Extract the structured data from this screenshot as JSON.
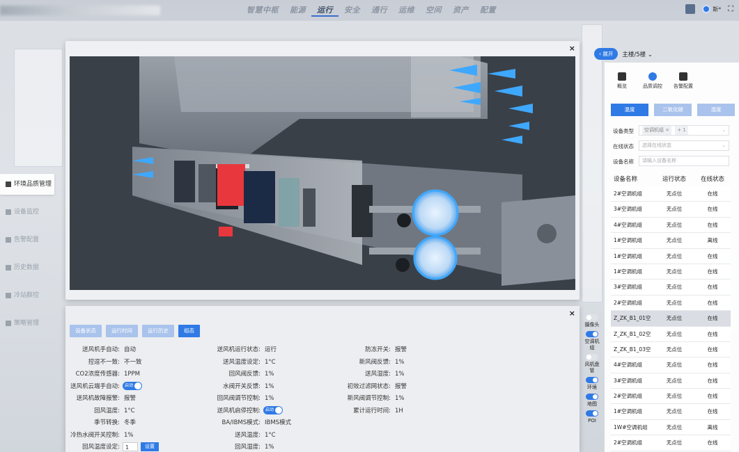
{
  "nav": {
    "items": [
      "智慧中枢",
      "能源",
      "运行",
      "安全",
      "通行",
      "运维",
      "空间",
      "资产",
      "配置"
    ],
    "active_index": 2
  },
  "top_right": {
    "user_name": "斯*"
  },
  "left_menu": {
    "items": [
      "环境品质管理",
      "设备监控",
      "告警配置",
      "历史数据",
      "冷站群控",
      "策略管理"
    ],
    "active_index": 0
  },
  "props": {
    "tabs": [
      "设备状态",
      "运行时间",
      "运行历史",
      "组态"
    ],
    "active_tab_index": 3,
    "col1": [
      {
        "label": "送风机手自动:",
        "value": "自动"
      },
      {
        "label": "控逗不一致:",
        "value": "不一致"
      },
      {
        "label": "CO2浓度传感器:",
        "value": "1PPM"
      },
      {
        "label": "送风机云端手自动:",
        "value": "",
        "toggle": "启动"
      },
      {
        "label": "送风机故障报警:",
        "value": "报警"
      },
      {
        "label": "回风温度:",
        "value": "1°C"
      },
      {
        "label": "季节转换:",
        "value": "冬季"
      },
      {
        "label": "冷热水阀开关控制:",
        "value": "1%"
      },
      {
        "label": "回风温度设定:",
        "value": "",
        "input": "1",
        "button": "设置"
      }
    ],
    "col2": [
      {
        "label": "送风机运行状态:",
        "value": "运行"
      },
      {
        "label": "送风温度设定:",
        "value": "1°C"
      },
      {
        "label": "回风阀反馈:",
        "value": "1%"
      },
      {
        "label": "水阀开关反馈:",
        "value": "1%"
      },
      {
        "label": "回风阀调节控制:",
        "value": "1%"
      },
      {
        "label": "送风机启停控制:",
        "value": "",
        "toggle": "启动"
      },
      {
        "label": "BA/IBMS模式:",
        "value": "IBMS模式"
      },
      {
        "label": "送风温度:",
        "value": "1°C"
      },
      {
        "label": "回风湿度:",
        "value": "1%"
      }
    ],
    "col3": [
      {
        "label": "防冻开关:",
        "value": "报警"
      },
      {
        "label": "新风阀反馈:",
        "value": "1%"
      },
      {
        "label": "送风湿度:",
        "value": "1%"
      },
      {
        "label": "初效过滤网状态:",
        "value": "报警"
      },
      {
        "label": "新风阀调节控制:",
        "value": "1%"
      },
      {
        "label": "累计运行时间:",
        "value": "1H"
      }
    ]
  },
  "layers": [
    {
      "label": "摄像头",
      "on": false
    },
    {
      "label": "空调机组",
      "on": true
    },
    {
      "label": "风机盘管",
      "on": false
    },
    {
      "label": "环境",
      "on": true
    },
    {
      "label": "地图",
      "on": true
    },
    {
      "label": "POI",
      "on": true
    }
  ],
  "right_panel": {
    "expand_label": "展开",
    "floor": "主楼/5楼",
    "icons": [
      {
        "name": "概览",
        "icon": "monitor-icon"
      },
      {
        "name": "品质调控",
        "icon": "share-icon"
      },
      {
        "name": "告警配置",
        "icon": "gear-icon"
      }
    ],
    "tabs": [
      "温度",
      "二氧化碳",
      "湿度"
    ],
    "active_tab_index": 0,
    "filters": {
      "type_label": "设备类型",
      "type_chip": "空调机组",
      "type_more": "+ 1",
      "status_label": "在线状态",
      "status_placeholder": "选择在线状态",
      "name_label": "设备名称",
      "name_placeholder": "请输入设备名称"
    },
    "table": {
      "headers": [
        "设备名称",
        "运行状态",
        "在线状态"
      ],
      "rows": [
        [
          "2#空调机组",
          "无点位",
          "在线"
        ],
        [
          "3#空调机组",
          "无点位",
          "在线"
        ],
        [
          "4#空调机组",
          "无点位",
          "在线"
        ],
        [
          "1#空调机组",
          "无点位",
          "离线"
        ],
        [
          "1#空调机组",
          "无点位",
          "在线"
        ],
        [
          "1#空调机组",
          "无点位",
          "在线"
        ],
        [
          "3#空调机组",
          "无点位",
          "在线"
        ],
        [
          "2#空调机组",
          "无点位",
          "在线"
        ],
        [
          "Z_ZK_B1_01空",
          "无点位",
          "在线"
        ],
        [
          "Z_ZK_B1_02空",
          "无点位",
          "在线"
        ],
        [
          "Z_ZK_B1_03空",
          "无点位",
          "在线"
        ],
        [
          "4#空调机组",
          "无点位",
          "在线"
        ],
        [
          "3#空调机组",
          "无点位",
          "在线"
        ],
        [
          "2#空调机组",
          "无点位",
          "在线"
        ],
        [
          "1#空调机组",
          "无点位",
          "在线"
        ],
        [
          "1W#空调机组",
          "无点位",
          "离线"
        ],
        [
          "2#空调机组",
          "无点位",
          "在线"
        ]
      ],
      "selected_index": 8
    }
  },
  "colors": {
    "accent": "#2f7ae5",
    "tab_inactive": "#a9c3ec",
    "scene_bg": "#3a4048",
    "damper_red": "#e8383d",
    "airflow": "#3ea8ff"
  }
}
